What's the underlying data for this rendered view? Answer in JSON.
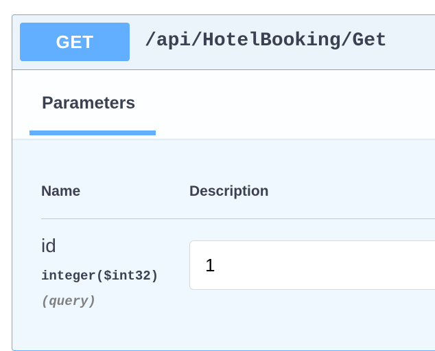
{
  "operation": {
    "method": "GET",
    "path": "/api/HotelBooking/Get"
  },
  "tabs": [
    {
      "label": "Parameters",
      "active": true
    }
  ],
  "table": {
    "headers": [
      "Name",
      "Description"
    ]
  },
  "parameters": [
    {
      "name": "id",
      "type": "integer",
      "format": "($int32)",
      "location": "(query)",
      "value": "1"
    }
  ],
  "colors": {
    "accent": "#61affe",
    "text": "#3b4151",
    "muted": "#808080",
    "background": "#ebf3fb"
  }
}
